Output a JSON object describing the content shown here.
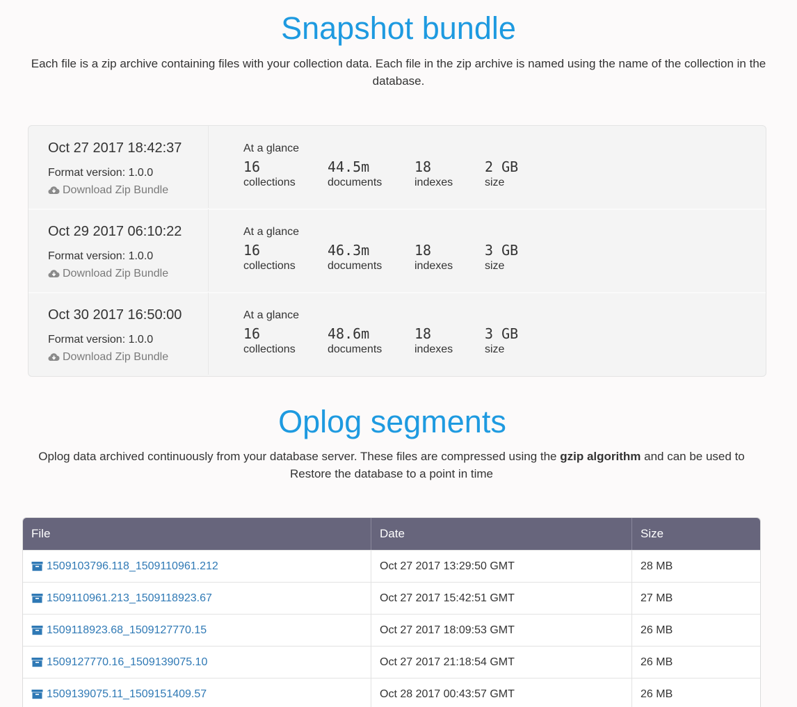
{
  "snapshot": {
    "title": "Snapshot bundle",
    "description": "Each file is a zip archive containing files with your collection data. Each file in the zip archive is named using the name of the collection in the database.",
    "rows": [
      {
        "date": "Oct 27 2017 18:42:37",
        "format": "Format version: 1.0.0",
        "download": "Download Zip Bundle",
        "glance": "At a glance",
        "collections": "16",
        "collections_label": "collections",
        "documents": "44.5m",
        "documents_label": "documents",
        "indexes": "18",
        "indexes_label": "indexes",
        "size": "2 GB",
        "size_label": "size"
      },
      {
        "date": "Oct 29 2017 06:10:22",
        "format": "Format version: 1.0.0",
        "download": "Download Zip Bundle",
        "glance": "At a glance",
        "collections": "16",
        "collections_label": "collections",
        "documents": "46.3m",
        "documents_label": "documents",
        "indexes": "18",
        "indexes_label": "indexes",
        "size": "3 GB",
        "size_label": "size"
      },
      {
        "date": "Oct 30 2017 16:50:00",
        "format": "Format version: 1.0.0",
        "download": "Download Zip Bundle",
        "glance": "At a glance",
        "collections": "16",
        "collections_label": "collections",
        "documents": "48.6m",
        "documents_label": "documents",
        "indexes": "18",
        "indexes_label": "indexes",
        "size": "3 GB",
        "size_label": "size"
      }
    ],
    "download_icon": "cloud-download-icon"
  },
  "oplog": {
    "title": "Oplog segments",
    "description_before": "Oplog data archived continuously from your database server. These files are compressed using the ",
    "description_bold": "gzip algorithm",
    "description_after": " and can be used to Restore the database to a point in time",
    "table": {
      "headers": [
        "File",
        "Date",
        "Size"
      ],
      "rows": [
        {
          "file": "1509103796.118_1509110961.212",
          "date": "Oct 27 2017 13:29:50 GMT",
          "size": "28 MB"
        },
        {
          "file": "1509110961.213_1509118923.67",
          "date": "Oct 27 2017 15:42:51 GMT",
          "size": "27 MB"
        },
        {
          "file": "1509118923.68_1509127770.15",
          "date": "Oct 27 2017 18:09:53 GMT",
          "size": "26 MB"
        },
        {
          "file": "1509127770.16_1509139075.10",
          "date": "Oct 27 2017 21:18:54 GMT",
          "size": "26 MB"
        },
        {
          "file": "1509139075.11_1509151409.57",
          "date": "Oct 28 2017 00:43:57 GMT",
          "size": "26 MB"
        }
      ]
    },
    "file_icon": "archive-icon"
  },
  "colors": {
    "title": "#1e9ae0",
    "table_header": "#67657c",
    "link": "#2f79b5"
  }
}
